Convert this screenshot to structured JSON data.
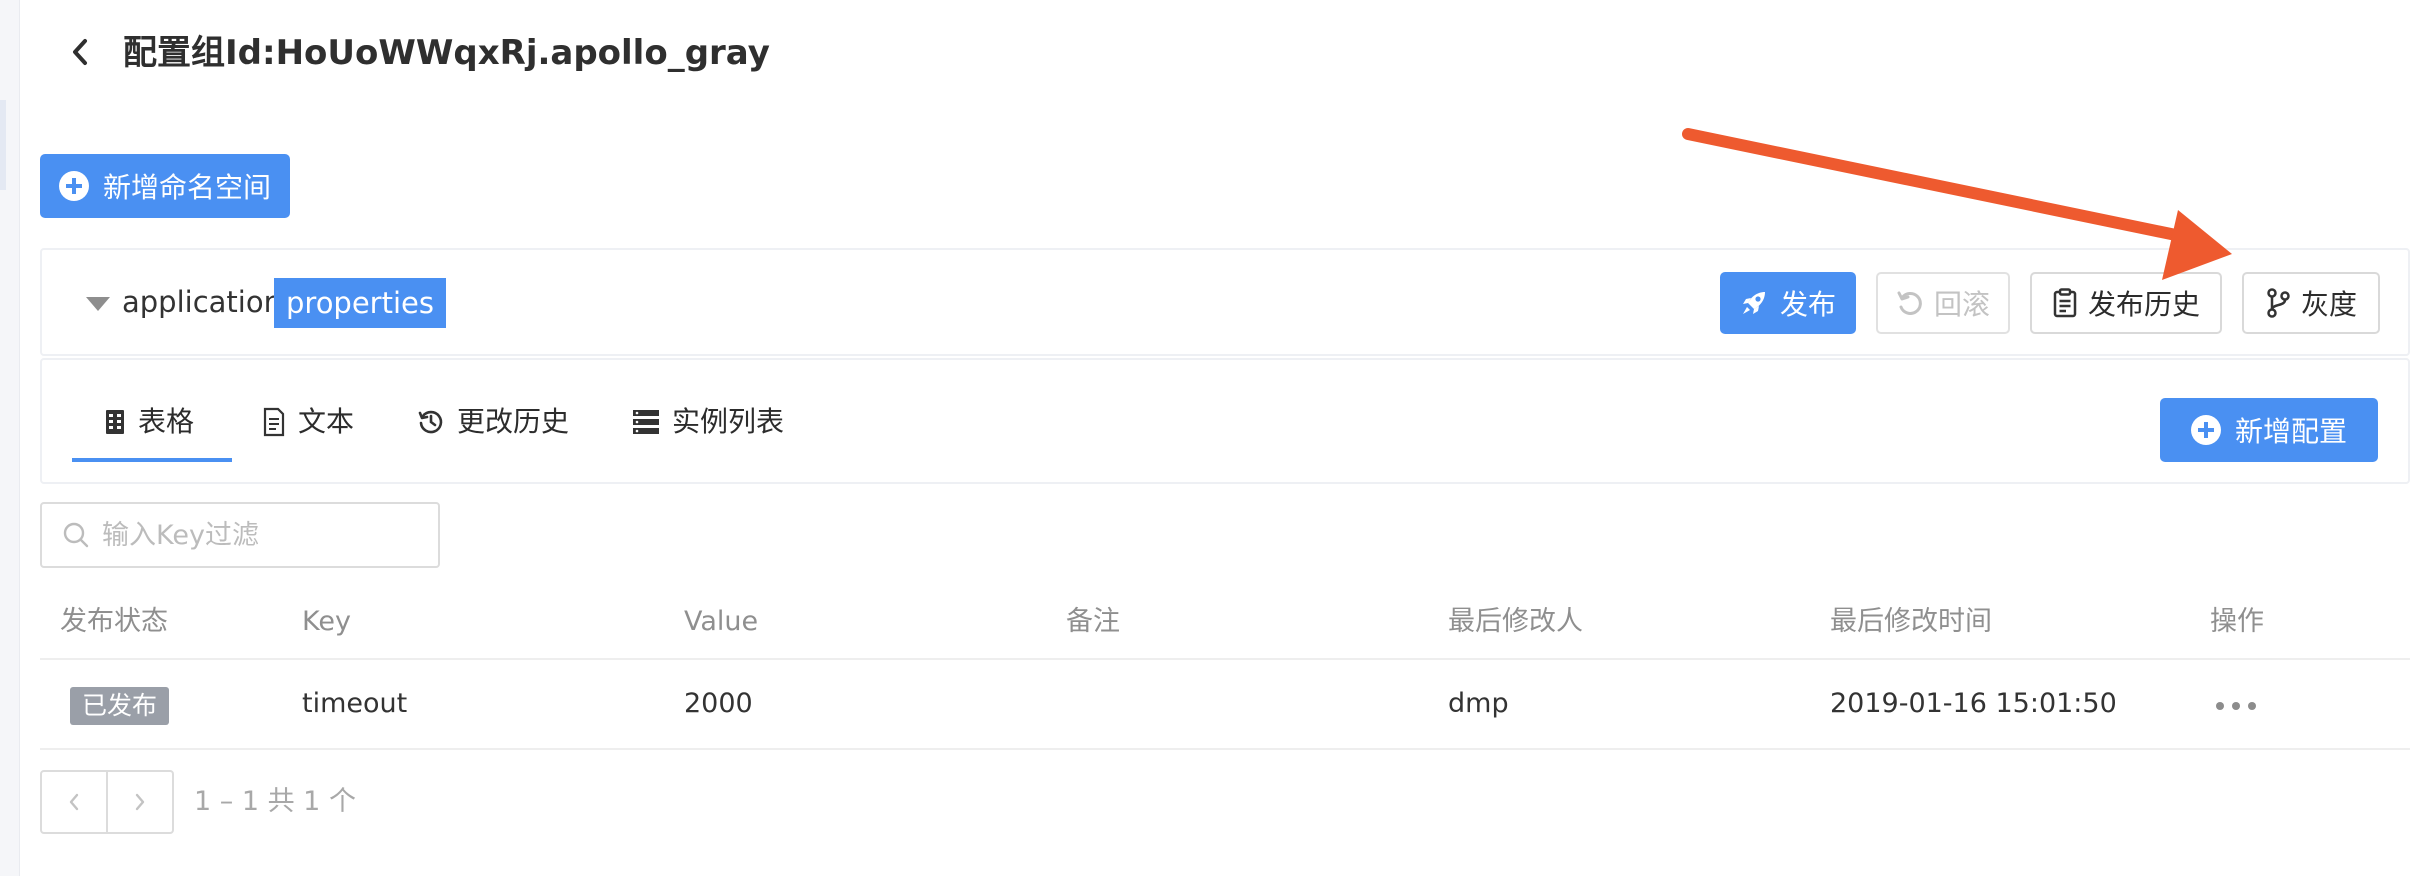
{
  "header": {
    "title": "配置组Id:HoUoWWqxRj.apollo_gray"
  },
  "toolbar": {
    "add_namespace_label": "新增命名空间"
  },
  "namespace": {
    "name": "application",
    "format": "properties",
    "actions": {
      "publish": "发布",
      "rollback": "回滚",
      "publish_history": "发布历史",
      "gray": "灰度"
    }
  },
  "tabs": [
    {
      "label": "表格",
      "icon": "table-icon"
    },
    {
      "label": "文本",
      "icon": "document-icon"
    },
    {
      "label": "更改历史",
      "icon": "history-icon"
    },
    {
      "label": "实例列表",
      "icon": "server-list-icon"
    }
  ],
  "add_config_label": "新增配置",
  "search": {
    "placeholder": "输入Key过滤",
    "value": ""
  },
  "table": {
    "columns": [
      "发布状态",
      "Key",
      "Value",
      "备注",
      "最后修改人",
      "最后修改时间",
      "操作"
    ],
    "rows": [
      {
        "status": "已发布",
        "key": "timeout",
        "value": "2000",
        "comment": "",
        "modifier": "dmp",
        "modified_time": "2019-01-16 15:01:50"
      }
    ]
  },
  "pagination": {
    "summary": "1 – 1 共 1 个"
  },
  "colors": {
    "primary": "#4a90f2",
    "annotation_arrow": "#ee5a2f",
    "status_badge": "#9a9fa8"
  }
}
